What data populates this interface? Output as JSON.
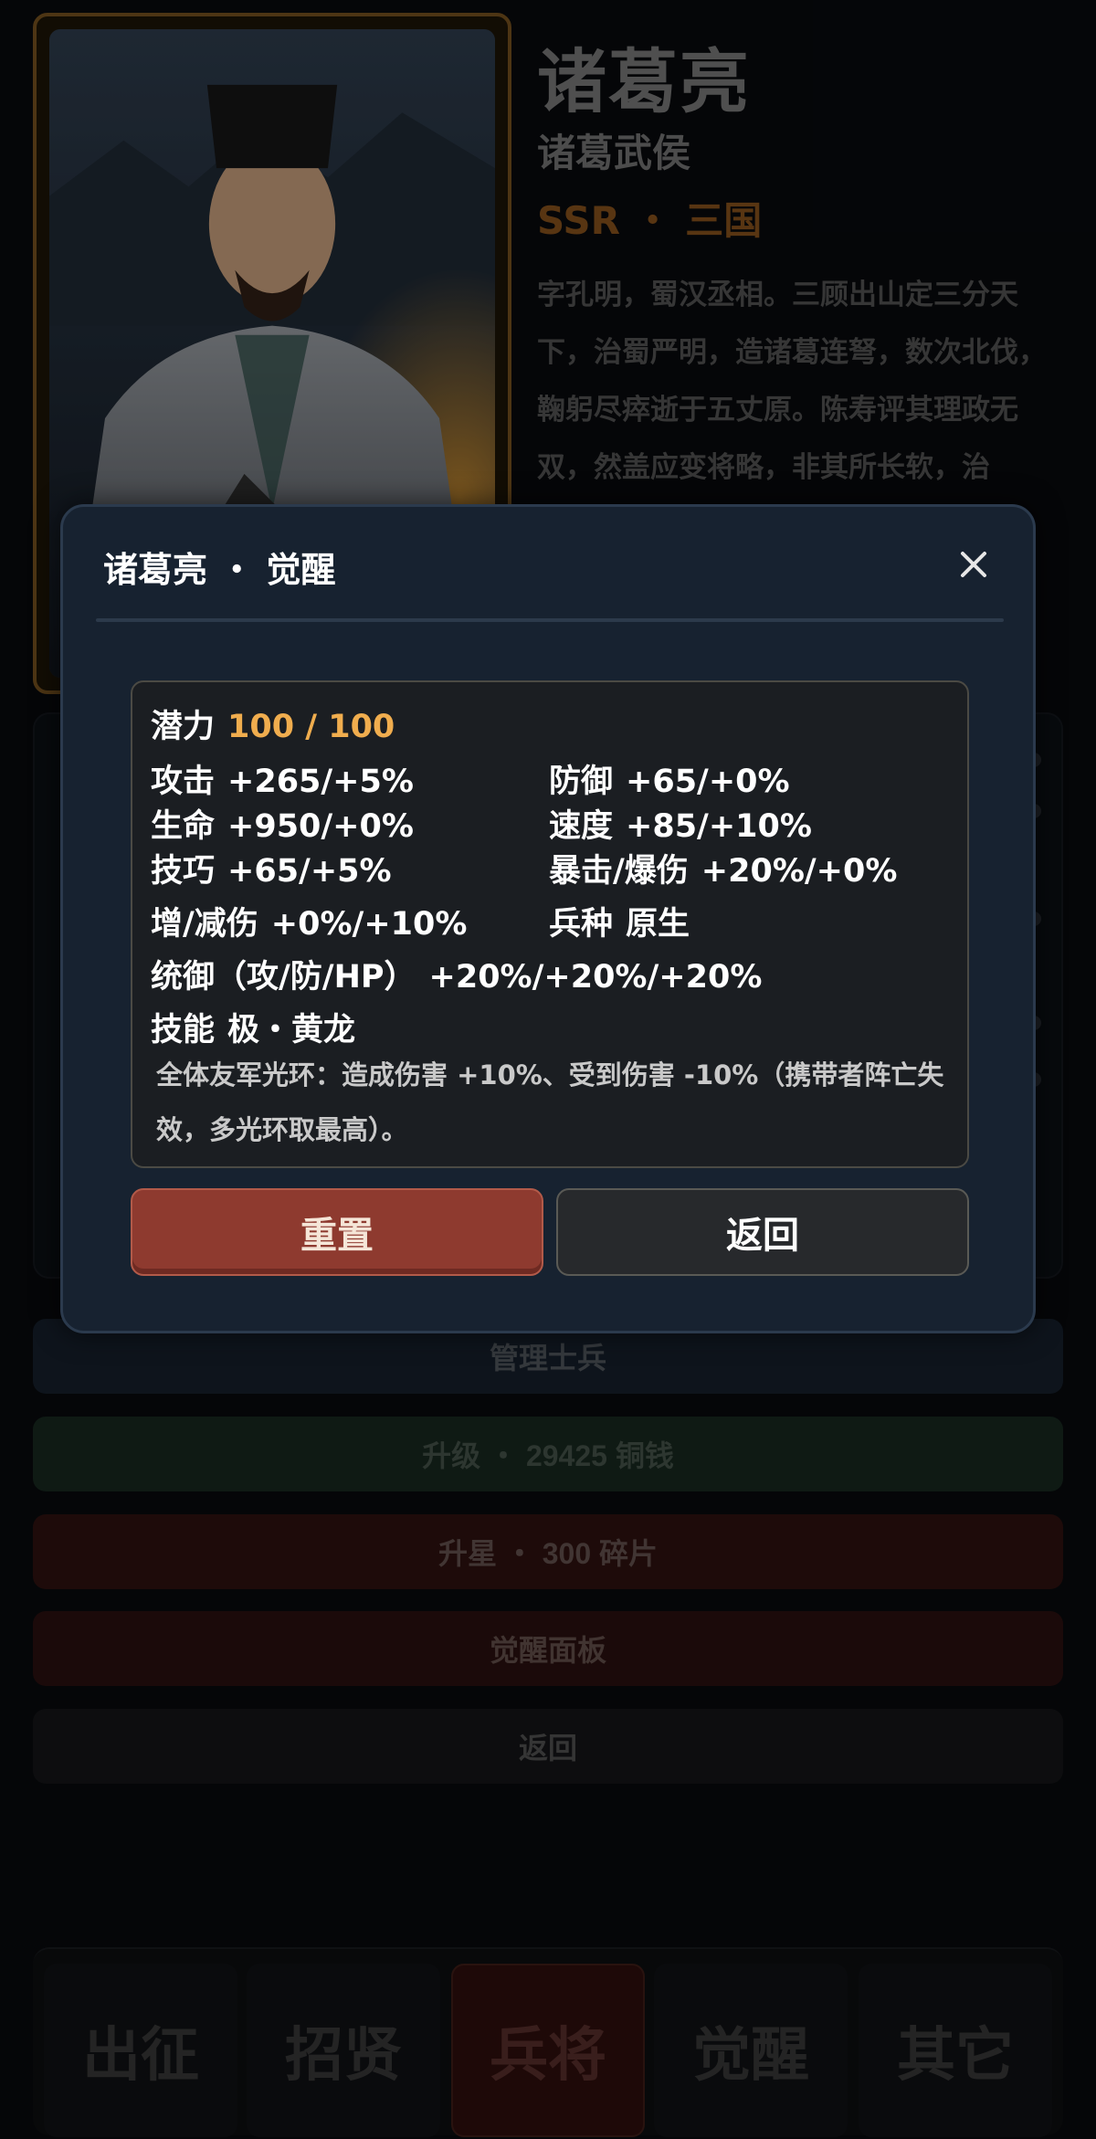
{
  "hero": {
    "name": "诸葛亮",
    "title": "诸葛武侯",
    "rarity": "SSR ・ 三国",
    "bio": "字孔明，蜀汉丞相。三顾出山定三分天下，治蜀严明，造诸葛连弩，数次北伐，鞠躬尽瘁逝于五丈原。陈寿评其理政无双，然盖应变将略，非其所长软，治"
  },
  "actions": {
    "manage_soldiers": "管理士兵",
    "upgrade": "升级 ・ 29425 铜钱",
    "star_up": "升星 ・ 300 碎片",
    "awaken_panel": "觉醒面板",
    "back": "返回"
  },
  "nav": {
    "tabs": [
      "出征",
      "招贤",
      "兵将",
      "觉醒",
      "其它"
    ],
    "active": "兵将"
  },
  "modal": {
    "title": "诸葛亮 ・ 觉醒",
    "close_icon": "close-icon",
    "potential": {
      "label": "潜力",
      "value": "100 / 100"
    },
    "stats": {
      "attack": {
        "label": "攻击",
        "value": "+265/+5%"
      },
      "defense": {
        "label": "防御",
        "value": "+65/+0%"
      },
      "hp": {
        "label": "生命",
        "value": "+950/+0%"
      },
      "speed": {
        "label": "速度",
        "value": "+85/+10%"
      },
      "skill": {
        "label": "技巧",
        "value": "+65/+5%"
      },
      "crit": {
        "label": "暴击/爆伤",
        "value": "+20%/+0%"
      },
      "dmg": {
        "label": "增/减伤",
        "value": "+0%/+10%"
      },
      "troop": {
        "label": "兵种",
        "value": "原生"
      },
      "command": {
        "label": "统御（攻/防/HP）",
        "value": "+20%/+20%/+20%"
      },
      "ability": {
        "label": "技能",
        "value": "极・黄龙"
      }
    },
    "ability_desc": "全体友军光环：造成伤害 +10%、受到伤害 -10%（携带者阵亡失效，多光环取最高）。",
    "reset_button": "重置",
    "return_button": "返回"
  },
  "colors": {
    "accent_gold": "#f0ad4e",
    "reset_red": "#8e3a2f",
    "modal_bg": "#172230"
  }
}
